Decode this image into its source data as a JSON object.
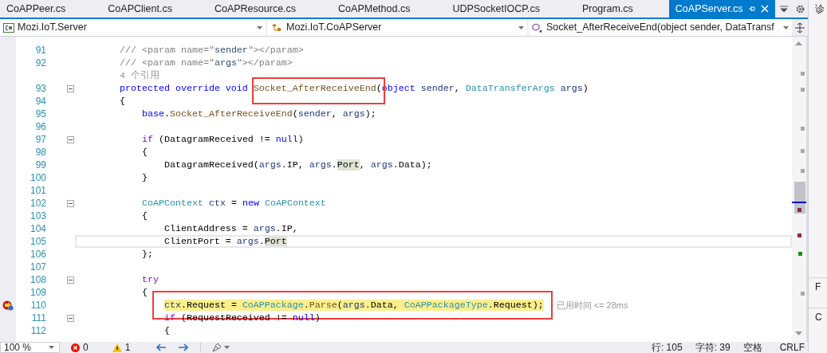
{
  "tabs": [
    {
      "label": "CoAPPeer.cs",
      "selected": false
    },
    {
      "label": "CoAPClient.cs",
      "selected": false
    },
    {
      "label": "CoAPResource.cs",
      "selected": false
    },
    {
      "label": "CoAPMethod.cs",
      "selected": false
    },
    {
      "label": "UDPSocketIOCP.cs",
      "selected": false
    },
    {
      "label": "Program.cs",
      "selected": false
    },
    {
      "label": "CoAPServer.cs",
      "selected": true
    }
  ],
  "navigation_bar": {
    "project": "Mozi.IoT.Server",
    "type": "Mozi.IoT.CoAPServer",
    "member": "Socket_AfterReceiveEnd(object sender, DataTransf"
  },
  "editor": {
    "lines": [
      {
        "kind": "code",
        "number": "91",
        "current": false,
        "foldable": false,
        "tokens": [
          {
            "kind": "comment",
            "text": "        /// <param name=\""
          },
          {
            "kind": "doc",
            "text": "sender"
          },
          {
            "kind": "comment",
            "text": "\"></param>"
          }
        ]
      },
      {
        "kind": "code",
        "number": "92",
        "current": false,
        "foldable": false,
        "tokens": [
          {
            "kind": "comment",
            "text": "        /// <param name=\""
          },
          {
            "kind": "doc",
            "text": "args"
          },
          {
            "kind": "comment",
            "text": "\"></param>"
          }
        ]
      },
      {
        "kind": "codelens",
        "text": "        4 个引用"
      },
      {
        "kind": "code",
        "number": "93",
        "current": false,
        "foldable": true,
        "tokens": [
          {
            "kind": "keyword",
            "text": "        protected override void "
          },
          {
            "kind": "method",
            "text": "Socket_AfterReceiveEnd",
            "boxed": true
          },
          {
            "kind": "plain",
            "text": "("
          },
          {
            "kind": "keyword",
            "text": "object"
          },
          {
            "kind": "param",
            "text": " sender"
          },
          {
            "kind": "plain",
            "text": ", "
          },
          {
            "kind": "type",
            "text": "DataTransferArgs"
          },
          {
            "kind": "param",
            "text": " args"
          },
          {
            "kind": "plain",
            "text": ")"
          }
        ]
      },
      {
        "kind": "code",
        "number": "94",
        "current": false,
        "foldable": false,
        "tokens": [
          {
            "kind": "plain",
            "text": "        {"
          }
        ]
      },
      {
        "kind": "code",
        "number": "95",
        "current": false,
        "foldable": false,
        "tokens": [
          {
            "kind": "keyword",
            "text": "            base"
          },
          {
            "kind": "plain",
            "text": "."
          },
          {
            "kind": "method",
            "text": "Socket_AfterReceiveEnd"
          },
          {
            "kind": "plain",
            "text": "("
          },
          {
            "kind": "param",
            "text": "sender"
          },
          {
            "kind": "plain",
            "text": ", "
          },
          {
            "kind": "param",
            "text": "args"
          },
          {
            "kind": "plain",
            "text": ");"
          }
        ]
      },
      {
        "kind": "code",
        "number": "96",
        "current": false,
        "foldable": false
      },
      {
        "kind": "code",
        "number": "97",
        "current": false,
        "foldable": true,
        "tokens": [
          {
            "kind": "control",
            "text": "            if"
          },
          {
            "kind": "plain",
            "text": " (DatagramReceived != "
          },
          {
            "kind": "keyword",
            "text": "null"
          },
          {
            "kind": "plain",
            "text": ")"
          }
        ]
      },
      {
        "kind": "code",
        "number": "98",
        "current": false,
        "foldable": false,
        "tokens": [
          {
            "kind": "plain",
            "text": "            {"
          }
        ]
      },
      {
        "kind": "code",
        "number": "99",
        "current": false,
        "foldable": false,
        "tokens": [
          {
            "kind": "plain",
            "text": "                DatagramReceived("
          },
          {
            "kind": "param",
            "text": "args"
          },
          {
            "kind": "plain",
            "text": ".IP, "
          },
          {
            "kind": "param",
            "text": "args"
          },
          {
            "kind": "plain",
            "text": "."
          },
          {
            "kind": "plain",
            "text": "Port",
            "reference": true
          },
          {
            "kind": "plain",
            "text": ", "
          },
          {
            "kind": "param",
            "text": "args"
          },
          {
            "kind": "plain",
            "text": ".Data);"
          }
        ]
      },
      {
        "kind": "code",
        "number": "100",
        "current": false,
        "foldable": false,
        "tokens": [
          {
            "kind": "plain",
            "text": "            }"
          }
        ]
      },
      {
        "kind": "code",
        "number": "101",
        "current": false,
        "foldable": false
      },
      {
        "kind": "code",
        "number": "102",
        "current": false,
        "foldable": true,
        "tokens": [
          {
            "kind": "type",
            "text": "            CoAPContext"
          },
          {
            "kind": "param",
            "text": " ctx"
          },
          {
            "kind": "plain",
            "text": " = "
          },
          {
            "kind": "keyword",
            "text": "new"
          },
          {
            "kind": "type",
            "text": " CoAPContext"
          }
        ]
      },
      {
        "kind": "code",
        "number": "103",
        "current": false,
        "foldable": false,
        "tokens": [
          {
            "kind": "plain",
            "text": "            {"
          }
        ]
      },
      {
        "kind": "code",
        "number": "104",
        "current": false,
        "foldable": false,
        "tokens": [
          {
            "kind": "plain",
            "text": "                ClientAddress = "
          },
          {
            "kind": "param",
            "text": "args"
          },
          {
            "kind": "plain",
            "text": ".IP,"
          }
        ]
      },
      {
        "kind": "code",
        "number": "105",
        "current": true,
        "foldable": false,
        "tokens": [
          {
            "kind": "plain",
            "text": "                ClientPort = "
          },
          {
            "kind": "param",
            "text": "args"
          },
          {
            "kind": "plain",
            "text": "."
          },
          {
            "kind": "plain",
            "text": "Port",
            "reference": true
          }
        ]
      },
      {
        "kind": "code",
        "number": "106",
        "current": false,
        "foldable": false,
        "tokens": [
          {
            "kind": "plain",
            "text": "            };"
          }
        ]
      },
      {
        "kind": "code",
        "number": "107",
        "current": false,
        "foldable": false
      },
      {
        "kind": "code",
        "number": "108",
        "current": false,
        "foldable": true,
        "tokens": [
          {
            "kind": "control",
            "text": "            try"
          }
        ]
      },
      {
        "kind": "code",
        "number": "109",
        "current": false,
        "foldable": false,
        "tokens": [
          {
            "kind": "plain",
            "text": "            {"
          }
        ]
      },
      {
        "kind": "code",
        "number": "110",
        "current": false,
        "foldable": false,
        "breakpoint": true,
        "executing": true,
        "boxed": true,
        "tip": "已用时间 <= 28ms",
        "tokens": [
          {
            "kind": "param",
            "text": "                ctx"
          },
          {
            "kind": "plain",
            "text": ".Request = "
          },
          {
            "kind": "type",
            "text": "CoAPPackage"
          },
          {
            "kind": "plain",
            "text": "."
          },
          {
            "kind": "method",
            "text": "Parse"
          },
          {
            "kind": "plain",
            "text": "("
          },
          {
            "kind": "param",
            "text": "args"
          },
          {
            "kind": "plain",
            "text": ".Data, "
          },
          {
            "kind": "type",
            "text": "CoAPPackageType"
          },
          {
            "kind": "plain",
            "text": ".Request);"
          }
        ]
      },
      {
        "kind": "code",
        "number": "111",
        "current": false,
        "foldable": true,
        "tokens": [
          {
            "kind": "control",
            "text": "                if"
          },
          {
            "kind": "plain",
            "text": " (RequestReceived != "
          },
          {
            "kind": "keyword",
            "text": "null"
          },
          {
            "kind": "plain",
            "text": ")"
          }
        ]
      },
      {
        "kind": "code",
        "number": "112",
        "current": false,
        "foldable": false,
        "tokens": [
          {
            "kind": "plain",
            "text": "                {"
          }
        ]
      }
    ]
  },
  "status_bar": {
    "zoom": "100 %",
    "errors": "0",
    "warnings": "1",
    "line": "行: 105",
    "column": "字符: 39",
    "indent": "空格",
    "line_ending": "CRLF"
  },
  "side_panel": {
    "labels": [
      "诊",
      "F",
      "C"
    ]
  }
}
